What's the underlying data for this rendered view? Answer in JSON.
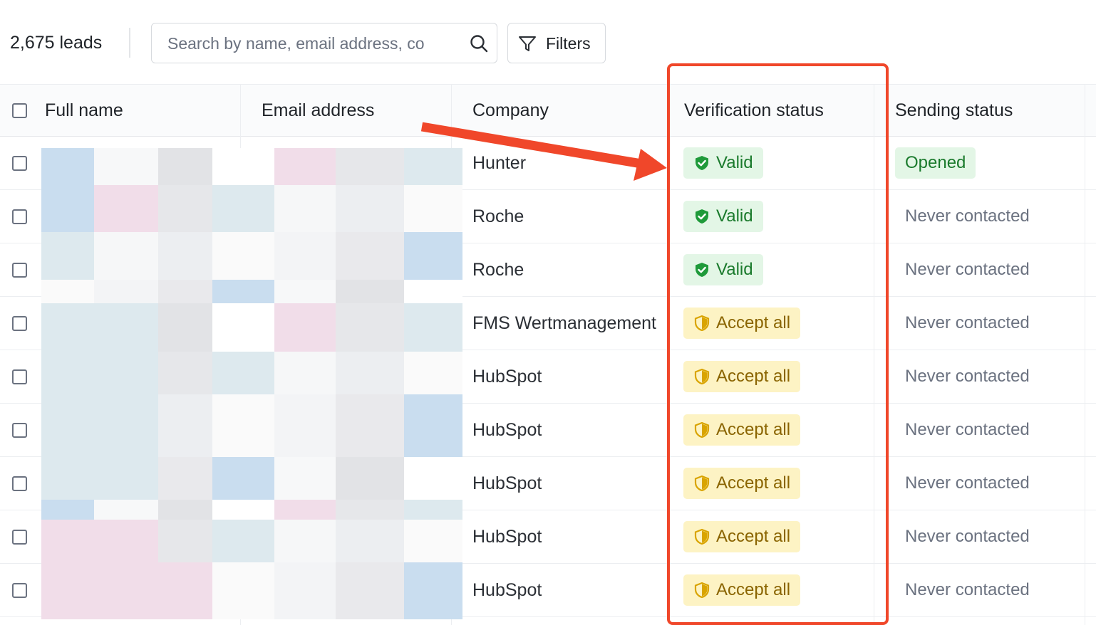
{
  "toolbar": {
    "lead_count": "2,675 leads",
    "search_placeholder": "Search by name, email address, co",
    "search_value": "",
    "filters_label": "Filters"
  },
  "columns": [
    "Full name",
    "Email address",
    "Company",
    "Verification status",
    "Sending status"
  ],
  "rows": [
    {
      "company": "Hunter",
      "verification": "Valid",
      "verification_type": "valid",
      "sending": "Opened",
      "sending_type": "badge"
    },
    {
      "company": "Roche",
      "verification": "Valid",
      "verification_type": "valid",
      "sending": "Never contacted",
      "sending_type": "text"
    },
    {
      "company": "Roche",
      "verification": "Valid",
      "verification_type": "valid",
      "sending": "Never contacted",
      "sending_type": "text"
    },
    {
      "company": "FMS Wertmanagement",
      "verification": "Accept all",
      "verification_type": "accept",
      "sending": "Never contacted",
      "sending_type": "text"
    },
    {
      "company": "HubSpot",
      "verification": "Accept all",
      "verification_type": "accept",
      "sending": "Never contacted",
      "sending_type": "text"
    },
    {
      "company": "HubSpot",
      "verification": "Accept all",
      "verification_type": "accept",
      "sending": "Never contacted",
      "sending_type": "text"
    },
    {
      "company": "HubSpot",
      "verification": "Accept all",
      "verification_type": "accept",
      "sending": "Never contacted",
      "sending_type": "text"
    },
    {
      "company": "HubSpot",
      "verification": "Accept all",
      "verification_type": "accept",
      "sending": "Never contacted",
      "sending_type": "text"
    },
    {
      "company": "HubSpot",
      "verification": "Accept all",
      "verification_type": "accept",
      "sending": "Never contacted",
      "sending_type": "text"
    }
  ],
  "colors": {
    "valid_bg": "#e3f6e6",
    "valid_fg": "#1a7a2c",
    "accept_bg": "#fdf3c4",
    "accept_fg": "#8a6400",
    "annotation": "#f0472a"
  },
  "icons": {
    "search": "search-icon",
    "filter": "filter-icon",
    "valid": "shield-check-icon",
    "accept": "shield-half-icon"
  }
}
